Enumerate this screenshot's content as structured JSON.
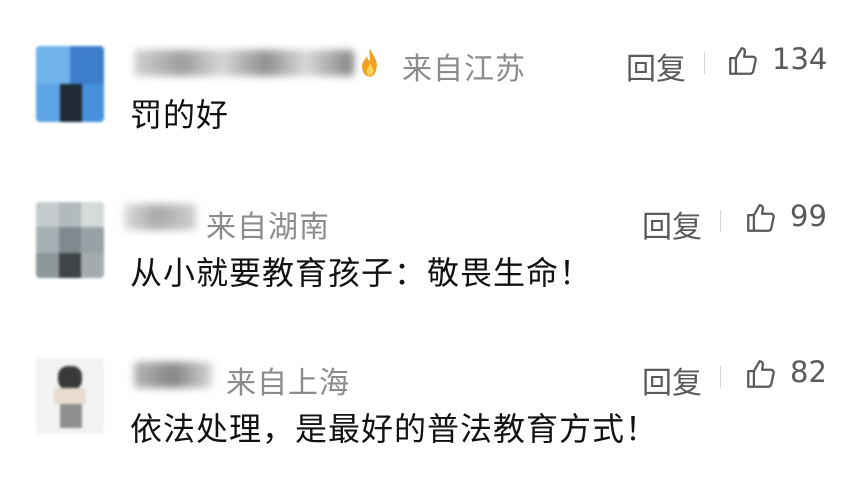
{
  "comments": [
    {
      "location": "来自江苏",
      "has_flame_badge": true,
      "reply_label": "回复",
      "like_count": "134",
      "text": "罚的好"
    },
    {
      "location": "来自湖南",
      "has_flame_badge": false,
      "reply_label": "回复",
      "like_count": "99",
      "text": "从小就要教育孩子：敬畏生命！"
    },
    {
      "location": "来自上海",
      "has_flame_badge": false,
      "reply_label": "回复",
      "like_count": "82",
      "text": "依法处理，是最好的普法教育方式！"
    }
  ],
  "colors": {
    "location_text": "#8c8c8c",
    "action_text": "#5a5a5a",
    "content_text": "#111111",
    "flame": "#f0a020"
  },
  "icons": {
    "like": "thumbs-up-icon",
    "badge": "flame-icon"
  }
}
